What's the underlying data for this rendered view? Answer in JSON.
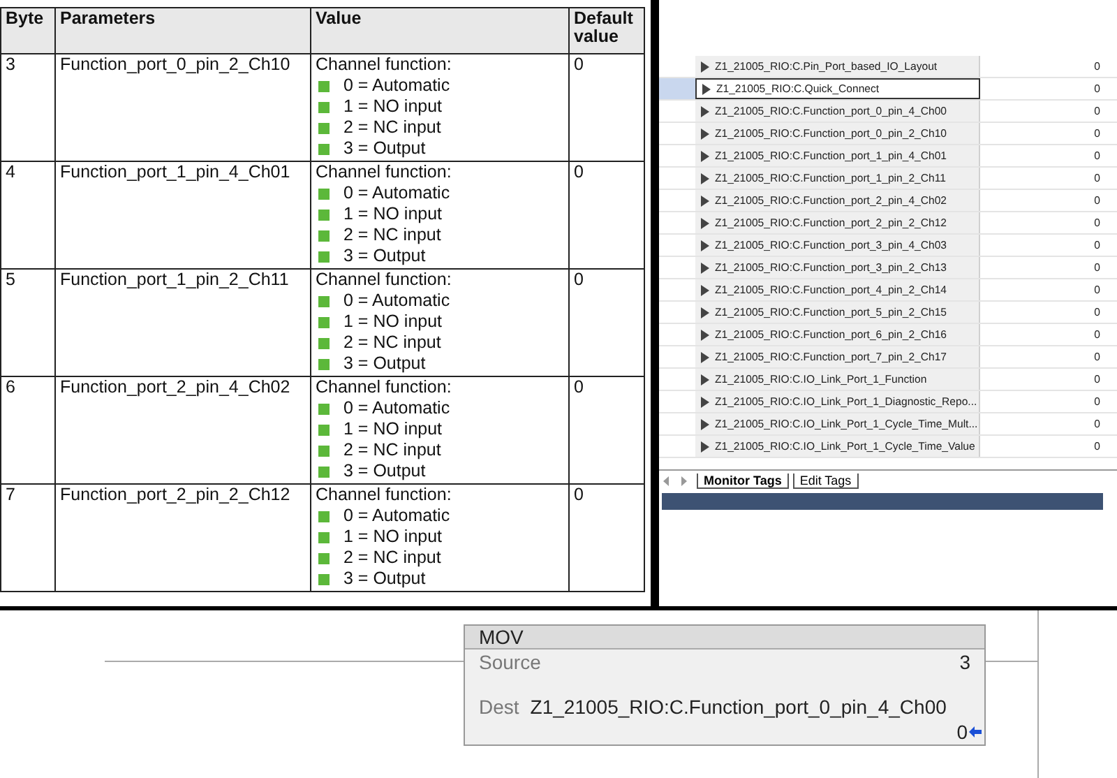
{
  "parameter_table": {
    "columns": [
      "Byte",
      "Parameters",
      "Value",
      "Default value"
    ],
    "rows": [
      {
        "byte": "3",
        "parameter": "Function_port_0_pin_2_Ch10",
        "value_title": "Channel function:",
        "options": [
          "0 = Automatic",
          "1 = NO input",
          "2 = NC input",
          "3 = Output"
        ],
        "default": "0"
      },
      {
        "byte": "4",
        "parameter": "Function_port_1_pin_4_Ch01",
        "value_title": "Channel function:",
        "options": [
          "0 = Automatic",
          "1 = NO input",
          "2 = NC input",
          "3 = Output"
        ],
        "default": "0"
      },
      {
        "byte": "5",
        "parameter": "Function_port_1_pin_2_Ch11",
        "value_title": "Channel function:",
        "options": [
          "0 = Automatic",
          "1 = NO input",
          "2 = NC input",
          "3 = Output"
        ],
        "default": "0"
      },
      {
        "byte": "6",
        "parameter": "Function_port_2_pin_4_Ch02",
        "value_title": "Channel function:",
        "options": [
          "0 = Automatic",
          "1 = NO input",
          "2 = NC input",
          "3 = Output"
        ],
        "default": "0"
      },
      {
        "byte": "7",
        "parameter": "Function_port_2_pin_2_Ch12",
        "value_title": "Channel function:",
        "options": [
          "0 = Automatic",
          "1 = NO input",
          "2 = NC input",
          "3 = Output"
        ],
        "default": "0"
      }
    ]
  },
  "tag_list": {
    "rows": [
      {
        "name": "Z1_21005_RIO:C.Pin_Port_based_IO_Layout",
        "value": "0",
        "selected": false
      },
      {
        "name": "Z1_21005_RIO:C.Quick_Connect",
        "value": "0",
        "selected": true
      },
      {
        "name": "Z1_21005_RIO:C.Function_port_0_pin_4_Ch00",
        "value": "0",
        "selected": false
      },
      {
        "name": "Z1_21005_RIO:C.Function_port_0_pin_2_Ch10",
        "value": "0",
        "selected": false
      },
      {
        "name": "Z1_21005_RIO:C.Function_port_1_pin_4_Ch01",
        "value": "0",
        "selected": false
      },
      {
        "name": "Z1_21005_RIO:C.Function_port_1_pin_2_Ch11",
        "value": "0",
        "selected": false
      },
      {
        "name": "Z1_21005_RIO:C.Function_port_2_pin_4_Ch02",
        "value": "0",
        "selected": false
      },
      {
        "name": "Z1_21005_RIO:C.Function_port_2_pin_2_Ch12",
        "value": "0",
        "selected": false
      },
      {
        "name": "Z1_21005_RIO:C.Function_port_3_pin_4_Ch03",
        "value": "0",
        "selected": false
      },
      {
        "name": "Z1_21005_RIO:C.Function_port_3_pin_2_Ch13",
        "value": "0",
        "selected": false
      },
      {
        "name": "Z1_21005_RIO:C.Function_port_4_pin_2_Ch14",
        "value": "0",
        "selected": false
      },
      {
        "name": "Z1_21005_RIO:C.Function_port_5_pin_2_Ch15",
        "value": "0",
        "selected": false
      },
      {
        "name": "Z1_21005_RIO:C.Function_port_6_pin_2_Ch16",
        "value": "0",
        "selected": false
      },
      {
        "name": "Z1_21005_RIO:C.Function_port_7_pin_2_Ch17",
        "value": "0",
        "selected": false
      },
      {
        "name": "Z1_21005_RIO:C.IO_Link_Port_1_Function",
        "value": "0",
        "selected": false
      },
      {
        "name": "Z1_21005_RIO:C.IO_Link_Port_1_Diagnostic_Repo...",
        "value": "0",
        "selected": false
      },
      {
        "name": "Z1_21005_RIO:C.IO_Link_Port_1_Cycle_Time_Mult...",
        "value": "0",
        "selected": false
      },
      {
        "name": "Z1_21005_RIO:C.IO_Link_Port_1_Cycle_Time_Value",
        "value": "0",
        "selected": false
      }
    ],
    "tabs": [
      {
        "label": "Monitor Tags",
        "selected": true
      },
      {
        "label": "Edit Tags",
        "selected": false
      }
    ]
  },
  "mov_instruction": {
    "title": "MOV",
    "source_label": "Source",
    "source_value": "3",
    "dest_label": "Dest",
    "dest_tag": "Z1_21005_RIO:C.Function_port_0_pin_4_Ch00",
    "dest_value": "0"
  }
}
